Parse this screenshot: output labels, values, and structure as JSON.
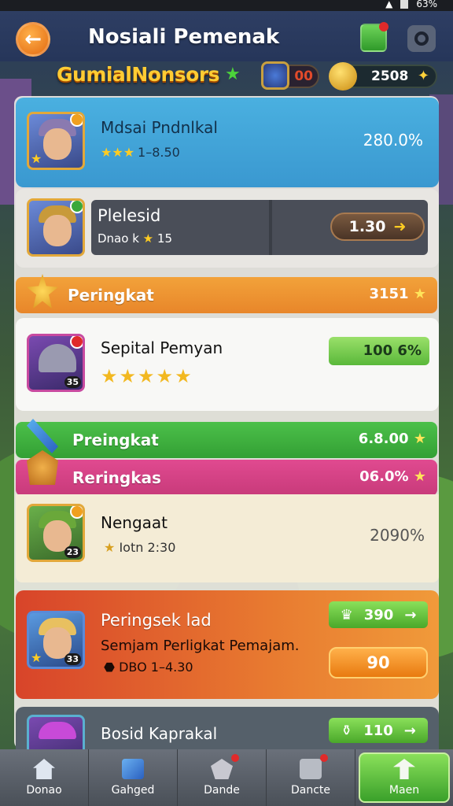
{
  "status_bar": {
    "battery_text": "63%"
  },
  "header": {
    "title": "Nosiali Pemenak"
  },
  "subheader": {
    "guild_name": "GumialNonsors",
    "gem_value": "00",
    "gold_value": "2508"
  },
  "cards": [
    {
      "name": "Mdsai Pndnlkal",
      "stars_text": "1–8.50",
      "percent": "280.0%"
    },
    {
      "name": "Plelesid",
      "sub": "Dnao k",
      "sub_val": "15",
      "button": "1.30"
    }
  ],
  "bands": [
    {
      "label": "Peringkat",
      "value": "3151"
    },
    {
      "label": "Preingkat",
      "value": "6.8.00"
    },
    {
      "label": "Reringkas",
      "value": "06.0%"
    }
  ],
  "card3": {
    "name": "Sepital Pemyan",
    "level": "35",
    "pill": "100 6%"
  },
  "card4": {
    "name": "Nengaat",
    "sub": "Iotn 2:30",
    "percent": "2090%",
    "level": "23"
  },
  "card5": {
    "name": "Peringsek lad",
    "desc": "Semjam Perligkat Pemajam.",
    "sub": "DBO 1–4.30",
    "btn_top": "390",
    "btn_bottom": "90",
    "level": "33"
  },
  "card6": {
    "name": "Bosid Kaprakal",
    "btn_top": "110"
  },
  "nav": [
    {
      "label": "Donao"
    },
    {
      "label": "Gahged"
    },
    {
      "label": "Dande"
    },
    {
      "label": "Dancte"
    },
    {
      "label": "Maen"
    }
  ],
  "colors": {
    "accent_orange": "#e8862a",
    "accent_green": "#33a034",
    "accent_pink": "#c83a7a",
    "accent_blue": "#3a98d0"
  }
}
